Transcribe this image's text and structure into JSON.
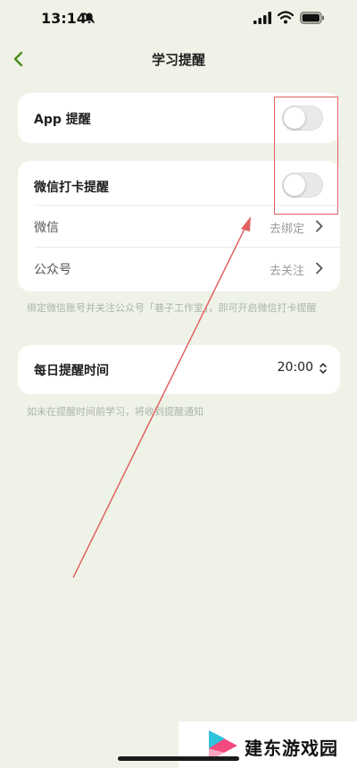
{
  "status_bar": {
    "time": "13:14"
  },
  "nav": {
    "title": "学习提醒"
  },
  "app_reminder": {
    "label": "App 提醒",
    "enabled": false
  },
  "wechat_section": {
    "checkin_label": "微信打卡提醒",
    "checkin_enabled": false,
    "rows": [
      {
        "label": "微信",
        "action": "去绑定"
      },
      {
        "label": "公众号",
        "action": "去关注"
      }
    ],
    "hint": "绑定微信账号并关注公众号「巷子工作室」，即可开启微信打卡提醒"
  },
  "daily_time": {
    "label": "每日提醒时间",
    "value": "20:00",
    "hint": "如未在提醒时间前学习，将收到提醒通知"
  },
  "watermark": {
    "text": "建东游戏园"
  },
  "colors": {
    "background": "#eff3e7",
    "back_arrow": "#4a8a1e",
    "annotation": "#e06262"
  }
}
